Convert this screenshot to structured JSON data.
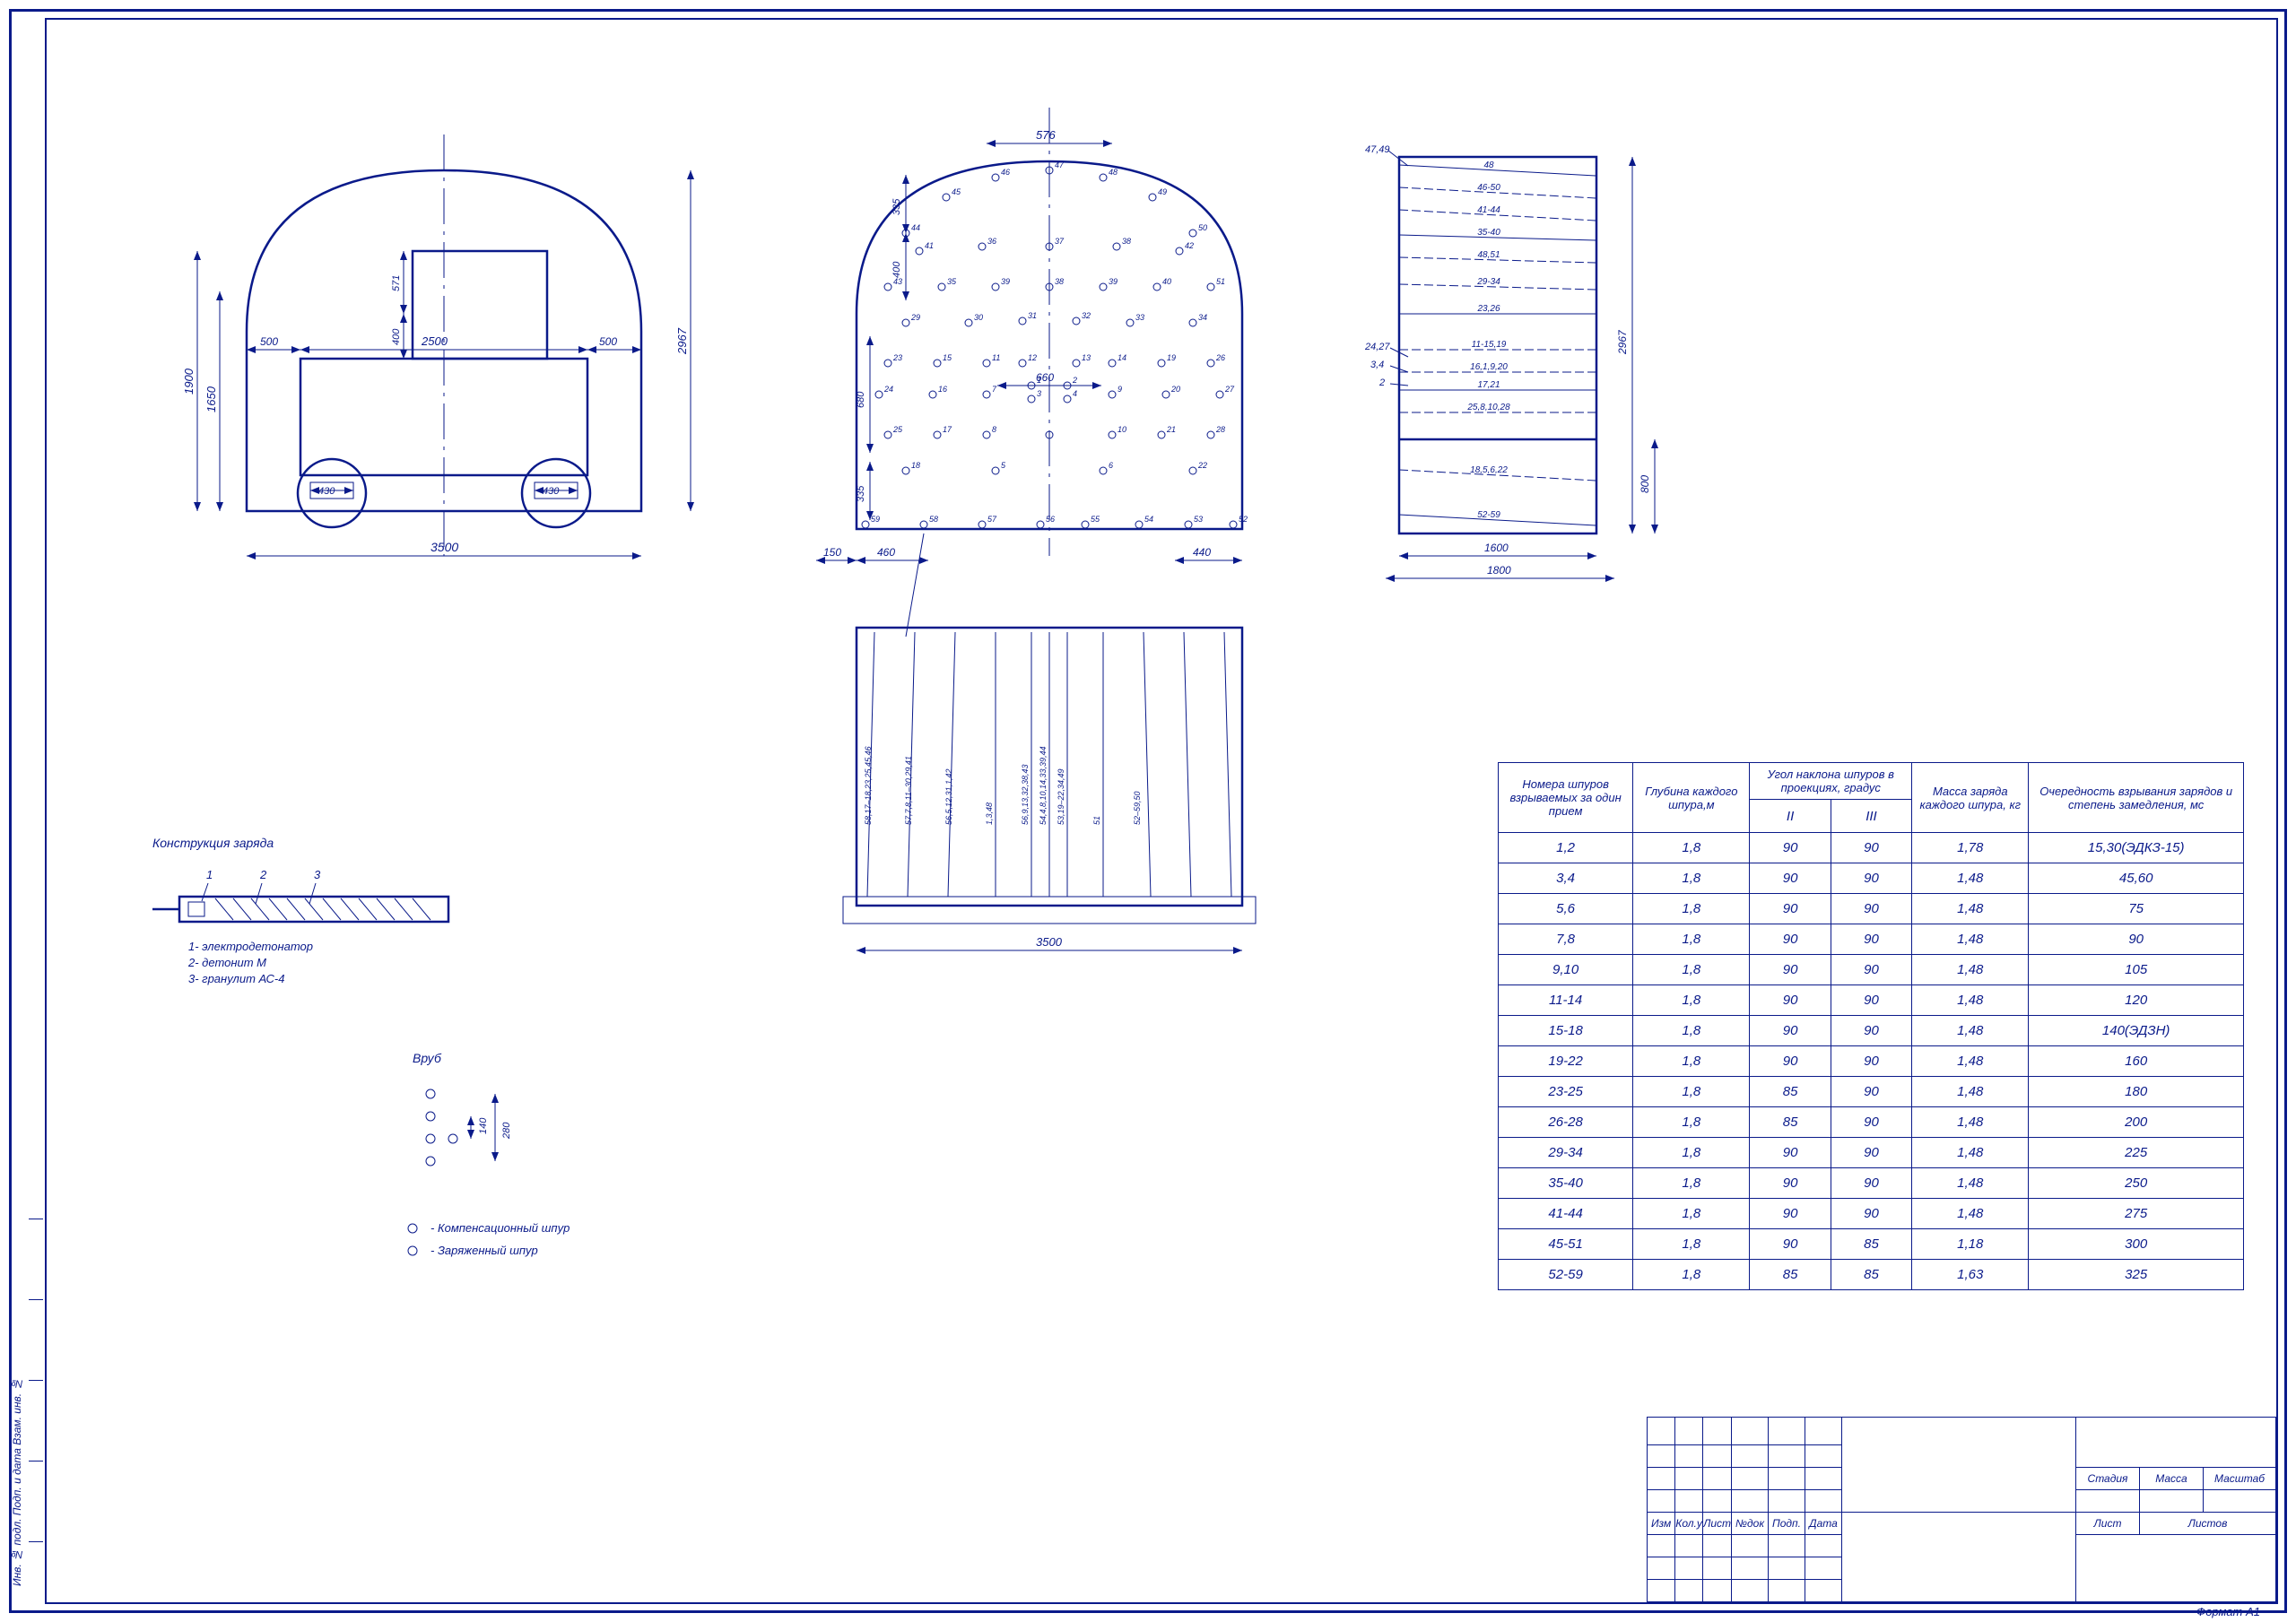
{
  "left_vehicle": {
    "dims": {
      "w3500": "3500",
      "w2500": "2500",
      "s500a": "500",
      "s500b": "500",
      "h1900": "1900",
      "h1650": "1650",
      "h2967": "2967",
      "h571": "571",
      "h400": "400",
      "w430a": "430",
      "w430b": "430"
    }
  },
  "center_face": {
    "dims": {
      "w576": "576",
      "w660": "660",
      "h335": "335",
      "h400": "400",
      "h680": "680",
      "h335b": "335",
      "w150": "150",
      "w460": "460",
      "w440": "440",
      "w3500": "3500"
    },
    "hole_nums": [
      "1",
      "2",
      "3",
      "4",
      "5",
      "6",
      "7",
      "8",
      "9",
      "10",
      "11",
      "12",
      "13",
      "14",
      "15",
      "16",
      "17",
      "18",
      "19",
      "20",
      "21",
      "22",
      "23",
      "24",
      "25",
      "26",
      "27",
      "28",
      "29",
      "30",
      "31",
      "32",
      "33",
      "34",
      "35",
      "36",
      "37",
      "38",
      "39",
      "40",
      "41",
      "42",
      "43",
      "44",
      "45",
      "46",
      "47",
      "48",
      "49",
      "50",
      "51",
      "52",
      "53",
      "54",
      "55",
      "56",
      "57",
      "58",
      "59"
    ],
    "side_labels": [
      "58,17–18,23,25,45,46",
      "57,7,8,11–30,29,41",
      "56,5,12,31,1,42",
      "1,3,48",
      "56,9,13,32,38,43",
      "54,4,8,10,14,33,39,44",
      "53,19–22,34,49",
      "51",
      "52–59,50"
    ]
  },
  "right_section": {
    "dims": {
      "w1600": "1600",
      "w1800": "1800",
      "h2967": "2967",
      "h800": "800"
    },
    "rows": [
      "48",
      "46-50",
      "41-44",
      "35-40",
      "48,51",
      "29-34",
      "23,26",
      "11-15,19",
      "16,1,9,20",
      "17,21",
      "25,8,10,28",
      "18,5,6,22",
      "52-59"
    ],
    "leaders": [
      "47,49",
      "24,27",
      "3,4",
      "2"
    ]
  },
  "charge_legend": {
    "title": "Конструкция заряда",
    "nums": [
      "1",
      "2",
      "3"
    ],
    "lines": [
      "1- электродетонатор",
      "2- детонит М",
      "3- гранулит АС-4"
    ]
  },
  "vrub": {
    "title": "Вруб",
    "d140": "140",
    "d280": "280",
    "l1": "- Компенсационный шпур",
    "l2": "- Заряженный шпур"
  },
  "table": {
    "headers": {
      "c1": "Номера шпуров взрываемых за один прием",
      "c2": "Глубина каждого шпура,м",
      "c3": "Угол наклона шпуров в проекциях, градус",
      "c3a": "II",
      "c3b": "III",
      "c4": "Масса заряда каждого шпура, кг",
      "c5": "Очередность взрывания зарядов и степень замедления, мс"
    },
    "rows": [
      [
        "1,2",
        "1,8",
        "90",
        "90",
        "1,78",
        "15,30(ЭДКЗ-15)"
      ],
      [
        "3,4",
        "1,8",
        "90",
        "90",
        "1,48",
        "45,60"
      ],
      [
        "5,6",
        "1,8",
        "90",
        "90",
        "1,48",
        "75"
      ],
      [
        "7,8",
        "1,8",
        "90",
        "90",
        "1,48",
        "90"
      ],
      [
        "9,10",
        "1,8",
        "90",
        "90",
        "1,48",
        "105"
      ],
      [
        "11-14",
        "1,8",
        "90",
        "90",
        "1,48",
        "120"
      ],
      [
        "15-18",
        "1,8",
        "90",
        "90",
        "1,48",
        "140(ЭДЗН)"
      ],
      [
        "19-22",
        "1,8",
        "90",
        "90",
        "1,48",
        "160"
      ],
      [
        "23-25",
        "1,8",
        "85",
        "90",
        "1,48",
        "180"
      ],
      [
        "26-28",
        "1,8",
        "85",
        "90",
        "1,48",
        "200"
      ],
      [
        "29-34",
        "1,8",
        "90",
        "90",
        "1,48",
        "225"
      ],
      [
        "35-40",
        "1,8",
        "90",
        "90",
        "1,48",
        "250"
      ],
      [
        "41-44",
        "1,8",
        "90",
        "90",
        "1,48",
        "275"
      ],
      [
        "45-51",
        "1,8",
        "90",
        "85",
        "1,18",
        "300"
      ],
      [
        "52-59",
        "1,8",
        "85",
        "85",
        "1,63",
        "325"
      ]
    ]
  },
  "titleblock": {
    "row1": [
      "Изм",
      "Кол.у",
      "Лист",
      "№док",
      "Подп.",
      "Дата"
    ],
    "right": {
      "stadia": "Стадия",
      "massa": "Масса",
      "masht": "Масштаб",
      "list": "Лист",
      "listov": "Листов"
    },
    "format": "Формат  А1"
  },
  "sidebar": "Инв. № подл.    Подп. и дата   Взам. инв. №"
}
